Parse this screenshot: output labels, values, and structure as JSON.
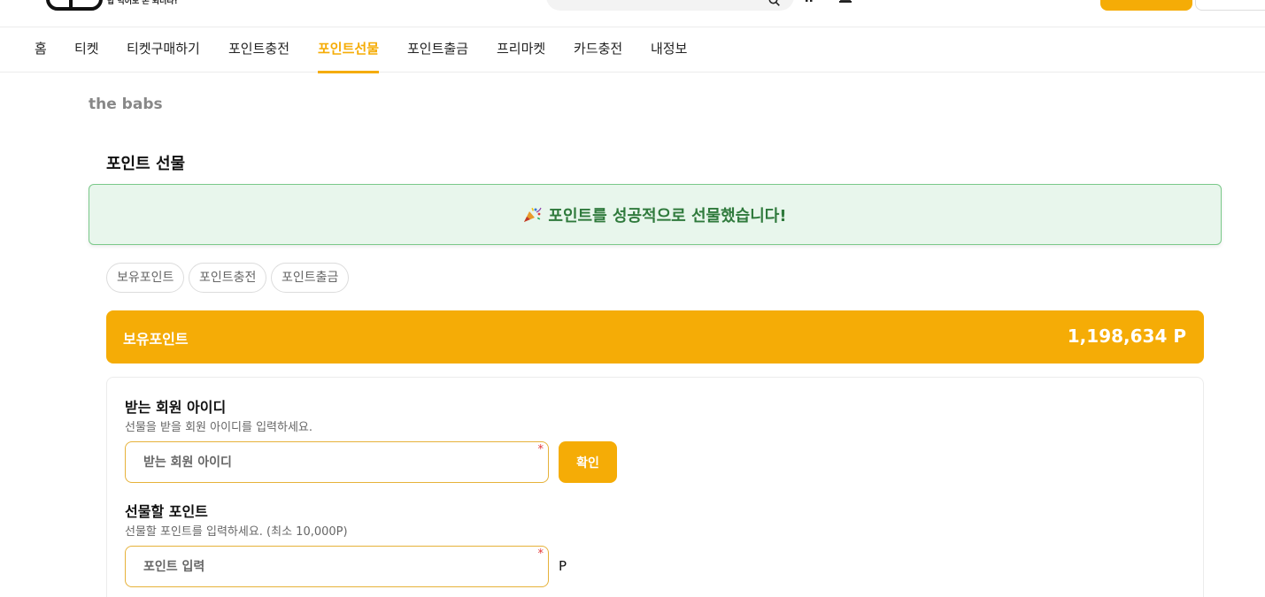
{
  "header": {
    "slogan": "밥 먹어도 돈 되더라!"
  },
  "nav": {
    "items": [
      {
        "label": "홈"
      },
      {
        "label": "티켓"
      },
      {
        "label": "티켓구매하기"
      },
      {
        "label": "포인트충전"
      },
      {
        "label": "포인트선물"
      },
      {
        "label": "포인트출금"
      },
      {
        "label": "프리마켓"
      },
      {
        "label": "카드충전"
      },
      {
        "label": "내정보"
      }
    ],
    "active": "포인트선물"
  },
  "breadcrumb": "the babs",
  "page_title": "포인트 선물",
  "success_message": "포인트를 성공적으로 선물했습니다!",
  "subtabs": [
    "보유포인트",
    "포인트충전",
    "포인트출금"
  ],
  "balance": {
    "label": "보유포인트",
    "value": "1,198,634 P"
  },
  "form": {
    "recipient": {
      "label": "받는 회원 아이디",
      "help": "선물을 받을 회원 아이디를 입력하세요.",
      "placeholder": "받는 회원 아이디",
      "value": "",
      "required": "*"
    },
    "confirm_label": "확인",
    "points": {
      "label": "선물할 포인트",
      "help": "선물할 포인트를 입력하세요. (최소 10,000P)",
      "placeholder": "포인트 입력",
      "value": "",
      "required": "*",
      "unit": "P"
    }
  },
  "colors": {
    "accent": "#f5ac06",
    "success_bg": "#e8f6ec",
    "success_text": "#2f7a3c",
    "required": "#e23a3a"
  }
}
